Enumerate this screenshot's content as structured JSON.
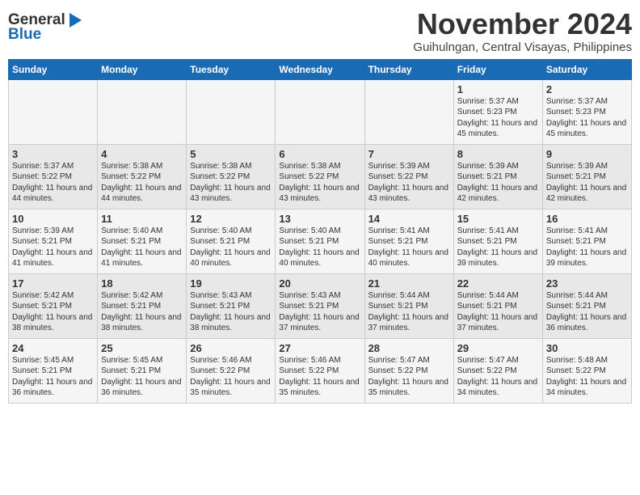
{
  "logo": {
    "line1": "General",
    "line2": "Blue"
  },
  "header": {
    "month": "November 2024",
    "location": "Guihulngan, Central Visayas, Philippines"
  },
  "weekdays": [
    "Sunday",
    "Monday",
    "Tuesday",
    "Wednesday",
    "Thursday",
    "Friday",
    "Saturday"
  ],
  "weeks": [
    [
      {
        "day": "",
        "info": ""
      },
      {
        "day": "",
        "info": ""
      },
      {
        "day": "",
        "info": ""
      },
      {
        "day": "",
        "info": ""
      },
      {
        "day": "",
        "info": ""
      },
      {
        "day": "1",
        "info": "Sunrise: 5:37 AM\nSunset: 5:23 PM\nDaylight: 11 hours and 45 minutes."
      },
      {
        "day": "2",
        "info": "Sunrise: 5:37 AM\nSunset: 5:23 PM\nDaylight: 11 hours and 45 minutes."
      }
    ],
    [
      {
        "day": "3",
        "info": "Sunrise: 5:37 AM\nSunset: 5:22 PM\nDaylight: 11 hours and 44 minutes."
      },
      {
        "day": "4",
        "info": "Sunrise: 5:38 AM\nSunset: 5:22 PM\nDaylight: 11 hours and 44 minutes."
      },
      {
        "day": "5",
        "info": "Sunrise: 5:38 AM\nSunset: 5:22 PM\nDaylight: 11 hours and 43 minutes."
      },
      {
        "day": "6",
        "info": "Sunrise: 5:38 AM\nSunset: 5:22 PM\nDaylight: 11 hours and 43 minutes."
      },
      {
        "day": "7",
        "info": "Sunrise: 5:39 AM\nSunset: 5:22 PM\nDaylight: 11 hours and 43 minutes."
      },
      {
        "day": "8",
        "info": "Sunrise: 5:39 AM\nSunset: 5:21 PM\nDaylight: 11 hours and 42 minutes."
      },
      {
        "day": "9",
        "info": "Sunrise: 5:39 AM\nSunset: 5:21 PM\nDaylight: 11 hours and 42 minutes."
      }
    ],
    [
      {
        "day": "10",
        "info": "Sunrise: 5:39 AM\nSunset: 5:21 PM\nDaylight: 11 hours and 41 minutes."
      },
      {
        "day": "11",
        "info": "Sunrise: 5:40 AM\nSunset: 5:21 PM\nDaylight: 11 hours and 41 minutes."
      },
      {
        "day": "12",
        "info": "Sunrise: 5:40 AM\nSunset: 5:21 PM\nDaylight: 11 hours and 40 minutes."
      },
      {
        "day": "13",
        "info": "Sunrise: 5:40 AM\nSunset: 5:21 PM\nDaylight: 11 hours and 40 minutes."
      },
      {
        "day": "14",
        "info": "Sunrise: 5:41 AM\nSunset: 5:21 PM\nDaylight: 11 hours and 40 minutes."
      },
      {
        "day": "15",
        "info": "Sunrise: 5:41 AM\nSunset: 5:21 PM\nDaylight: 11 hours and 39 minutes."
      },
      {
        "day": "16",
        "info": "Sunrise: 5:41 AM\nSunset: 5:21 PM\nDaylight: 11 hours and 39 minutes."
      }
    ],
    [
      {
        "day": "17",
        "info": "Sunrise: 5:42 AM\nSunset: 5:21 PM\nDaylight: 11 hours and 38 minutes."
      },
      {
        "day": "18",
        "info": "Sunrise: 5:42 AM\nSunset: 5:21 PM\nDaylight: 11 hours and 38 minutes."
      },
      {
        "day": "19",
        "info": "Sunrise: 5:43 AM\nSunset: 5:21 PM\nDaylight: 11 hours and 38 minutes."
      },
      {
        "day": "20",
        "info": "Sunrise: 5:43 AM\nSunset: 5:21 PM\nDaylight: 11 hours and 37 minutes."
      },
      {
        "day": "21",
        "info": "Sunrise: 5:44 AM\nSunset: 5:21 PM\nDaylight: 11 hours and 37 minutes."
      },
      {
        "day": "22",
        "info": "Sunrise: 5:44 AM\nSunset: 5:21 PM\nDaylight: 11 hours and 37 minutes."
      },
      {
        "day": "23",
        "info": "Sunrise: 5:44 AM\nSunset: 5:21 PM\nDaylight: 11 hours and 36 minutes."
      }
    ],
    [
      {
        "day": "24",
        "info": "Sunrise: 5:45 AM\nSunset: 5:21 PM\nDaylight: 11 hours and 36 minutes."
      },
      {
        "day": "25",
        "info": "Sunrise: 5:45 AM\nSunset: 5:21 PM\nDaylight: 11 hours and 36 minutes."
      },
      {
        "day": "26",
        "info": "Sunrise: 5:46 AM\nSunset: 5:22 PM\nDaylight: 11 hours and 35 minutes."
      },
      {
        "day": "27",
        "info": "Sunrise: 5:46 AM\nSunset: 5:22 PM\nDaylight: 11 hours and 35 minutes."
      },
      {
        "day": "28",
        "info": "Sunrise: 5:47 AM\nSunset: 5:22 PM\nDaylight: 11 hours and 35 minutes."
      },
      {
        "day": "29",
        "info": "Sunrise: 5:47 AM\nSunset: 5:22 PM\nDaylight: 11 hours and 34 minutes."
      },
      {
        "day": "30",
        "info": "Sunrise: 5:48 AM\nSunset: 5:22 PM\nDaylight: 11 hours and 34 minutes."
      }
    ]
  ]
}
